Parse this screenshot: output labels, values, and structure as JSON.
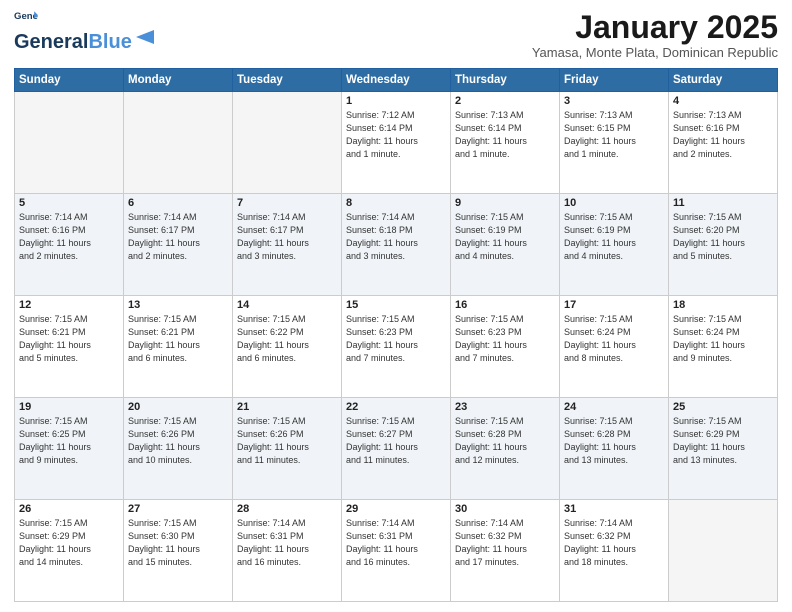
{
  "header": {
    "logo_line1": "General",
    "logo_line2": "Blue",
    "month": "January 2025",
    "location": "Yamasa, Monte Plata, Dominican Republic"
  },
  "weekdays": [
    "Sunday",
    "Monday",
    "Tuesday",
    "Wednesday",
    "Thursday",
    "Friday",
    "Saturday"
  ],
  "weeks": [
    [
      {
        "day": "",
        "info": ""
      },
      {
        "day": "",
        "info": ""
      },
      {
        "day": "",
        "info": ""
      },
      {
        "day": "1",
        "info": "Sunrise: 7:12 AM\nSunset: 6:14 PM\nDaylight: 11 hours\nand 1 minute."
      },
      {
        "day": "2",
        "info": "Sunrise: 7:13 AM\nSunset: 6:14 PM\nDaylight: 11 hours\nand 1 minute."
      },
      {
        "day": "3",
        "info": "Sunrise: 7:13 AM\nSunset: 6:15 PM\nDaylight: 11 hours\nand 1 minute."
      },
      {
        "day": "4",
        "info": "Sunrise: 7:13 AM\nSunset: 6:16 PM\nDaylight: 11 hours\nand 2 minutes."
      }
    ],
    [
      {
        "day": "5",
        "info": "Sunrise: 7:14 AM\nSunset: 6:16 PM\nDaylight: 11 hours\nand 2 minutes."
      },
      {
        "day": "6",
        "info": "Sunrise: 7:14 AM\nSunset: 6:17 PM\nDaylight: 11 hours\nand 2 minutes."
      },
      {
        "day": "7",
        "info": "Sunrise: 7:14 AM\nSunset: 6:17 PM\nDaylight: 11 hours\nand 3 minutes."
      },
      {
        "day": "8",
        "info": "Sunrise: 7:14 AM\nSunset: 6:18 PM\nDaylight: 11 hours\nand 3 minutes."
      },
      {
        "day": "9",
        "info": "Sunrise: 7:15 AM\nSunset: 6:19 PM\nDaylight: 11 hours\nand 4 minutes."
      },
      {
        "day": "10",
        "info": "Sunrise: 7:15 AM\nSunset: 6:19 PM\nDaylight: 11 hours\nand 4 minutes."
      },
      {
        "day": "11",
        "info": "Sunrise: 7:15 AM\nSunset: 6:20 PM\nDaylight: 11 hours\nand 5 minutes."
      }
    ],
    [
      {
        "day": "12",
        "info": "Sunrise: 7:15 AM\nSunset: 6:21 PM\nDaylight: 11 hours\nand 5 minutes."
      },
      {
        "day": "13",
        "info": "Sunrise: 7:15 AM\nSunset: 6:21 PM\nDaylight: 11 hours\nand 6 minutes."
      },
      {
        "day": "14",
        "info": "Sunrise: 7:15 AM\nSunset: 6:22 PM\nDaylight: 11 hours\nand 6 minutes."
      },
      {
        "day": "15",
        "info": "Sunrise: 7:15 AM\nSunset: 6:23 PM\nDaylight: 11 hours\nand 7 minutes."
      },
      {
        "day": "16",
        "info": "Sunrise: 7:15 AM\nSunset: 6:23 PM\nDaylight: 11 hours\nand 7 minutes."
      },
      {
        "day": "17",
        "info": "Sunrise: 7:15 AM\nSunset: 6:24 PM\nDaylight: 11 hours\nand 8 minutes."
      },
      {
        "day": "18",
        "info": "Sunrise: 7:15 AM\nSunset: 6:24 PM\nDaylight: 11 hours\nand 9 minutes."
      }
    ],
    [
      {
        "day": "19",
        "info": "Sunrise: 7:15 AM\nSunset: 6:25 PM\nDaylight: 11 hours\nand 9 minutes."
      },
      {
        "day": "20",
        "info": "Sunrise: 7:15 AM\nSunset: 6:26 PM\nDaylight: 11 hours\nand 10 minutes."
      },
      {
        "day": "21",
        "info": "Sunrise: 7:15 AM\nSunset: 6:26 PM\nDaylight: 11 hours\nand 11 minutes."
      },
      {
        "day": "22",
        "info": "Sunrise: 7:15 AM\nSunset: 6:27 PM\nDaylight: 11 hours\nand 11 minutes."
      },
      {
        "day": "23",
        "info": "Sunrise: 7:15 AM\nSunset: 6:28 PM\nDaylight: 11 hours\nand 12 minutes."
      },
      {
        "day": "24",
        "info": "Sunrise: 7:15 AM\nSunset: 6:28 PM\nDaylight: 11 hours\nand 13 minutes."
      },
      {
        "day": "25",
        "info": "Sunrise: 7:15 AM\nSunset: 6:29 PM\nDaylight: 11 hours\nand 13 minutes."
      }
    ],
    [
      {
        "day": "26",
        "info": "Sunrise: 7:15 AM\nSunset: 6:29 PM\nDaylight: 11 hours\nand 14 minutes."
      },
      {
        "day": "27",
        "info": "Sunrise: 7:15 AM\nSunset: 6:30 PM\nDaylight: 11 hours\nand 15 minutes."
      },
      {
        "day": "28",
        "info": "Sunrise: 7:14 AM\nSunset: 6:31 PM\nDaylight: 11 hours\nand 16 minutes."
      },
      {
        "day": "29",
        "info": "Sunrise: 7:14 AM\nSunset: 6:31 PM\nDaylight: 11 hours\nand 16 minutes."
      },
      {
        "day": "30",
        "info": "Sunrise: 7:14 AM\nSunset: 6:32 PM\nDaylight: 11 hours\nand 17 minutes."
      },
      {
        "day": "31",
        "info": "Sunrise: 7:14 AM\nSunset: 6:32 PM\nDaylight: 11 hours\nand 18 minutes."
      },
      {
        "day": "",
        "info": ""
      }
    ]
  ]
}
